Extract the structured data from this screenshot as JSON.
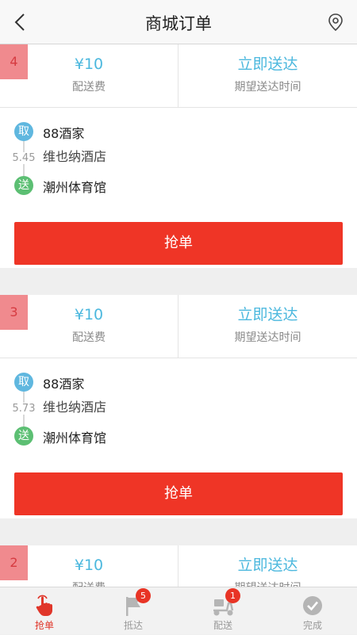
{
  "header": {
    "title": "商城订单"
  },
  "orders": [
    {
      "index": "4",
      "fee": "¥10",
      "fee_label": "配送费",
      "time": "立即送达",
      "time_label": "期望送达时间",
      "pickup_badge": "取",
      "pickup_name": "88酒家",
      "pickup_sub": "维也纳酒店",
      "distance": "5.45",
      "drop_badge": "送",
      "drop_name": "潮州体育馆",
      "action": "抢单"
    },
    {
      "index": "3",
      "fee": "¥10",
      "fee_label": "配送费",
      "time": "立即送达",
      "time_label": "期望送达时间",
      "pickup_badge": "取",
      "pickup_name": "88酒家",
      "pickup_sub": "维也纳酒店",
      "distance": "5.73",
      "drop_badge": "送",
      "drop_name": "潮州体育馆",
      "action": "抢单"
    },
    {
      "index": "2",
      "fee": "¥10",
      "fee_label": "配送费",
      "time": "立即送达",
      "time_label": "期望送达时间"
    }
  ],
  "tabbar": {
    "items": [
      {
        "label": "抢单",
        "icon": "hand-tap-icon",
        "active": true
      },
      {
        "label": "抵达",
        "icon": "flag-icon",
        "count": "5"
      },
      {
        "label": "配送",
        "icon": "scooter-icon",
        "count": "1"
      },
      {
        "label": "完成",
        "icon": "check-circle-icon"
      }
    ]
  },
  "colors": {
    "accent": "#ef3526",
    "link": "#4cb8de",
    "pickup": "#5fb7df",
    "dropoff": "#5cbf73"
  }
}
